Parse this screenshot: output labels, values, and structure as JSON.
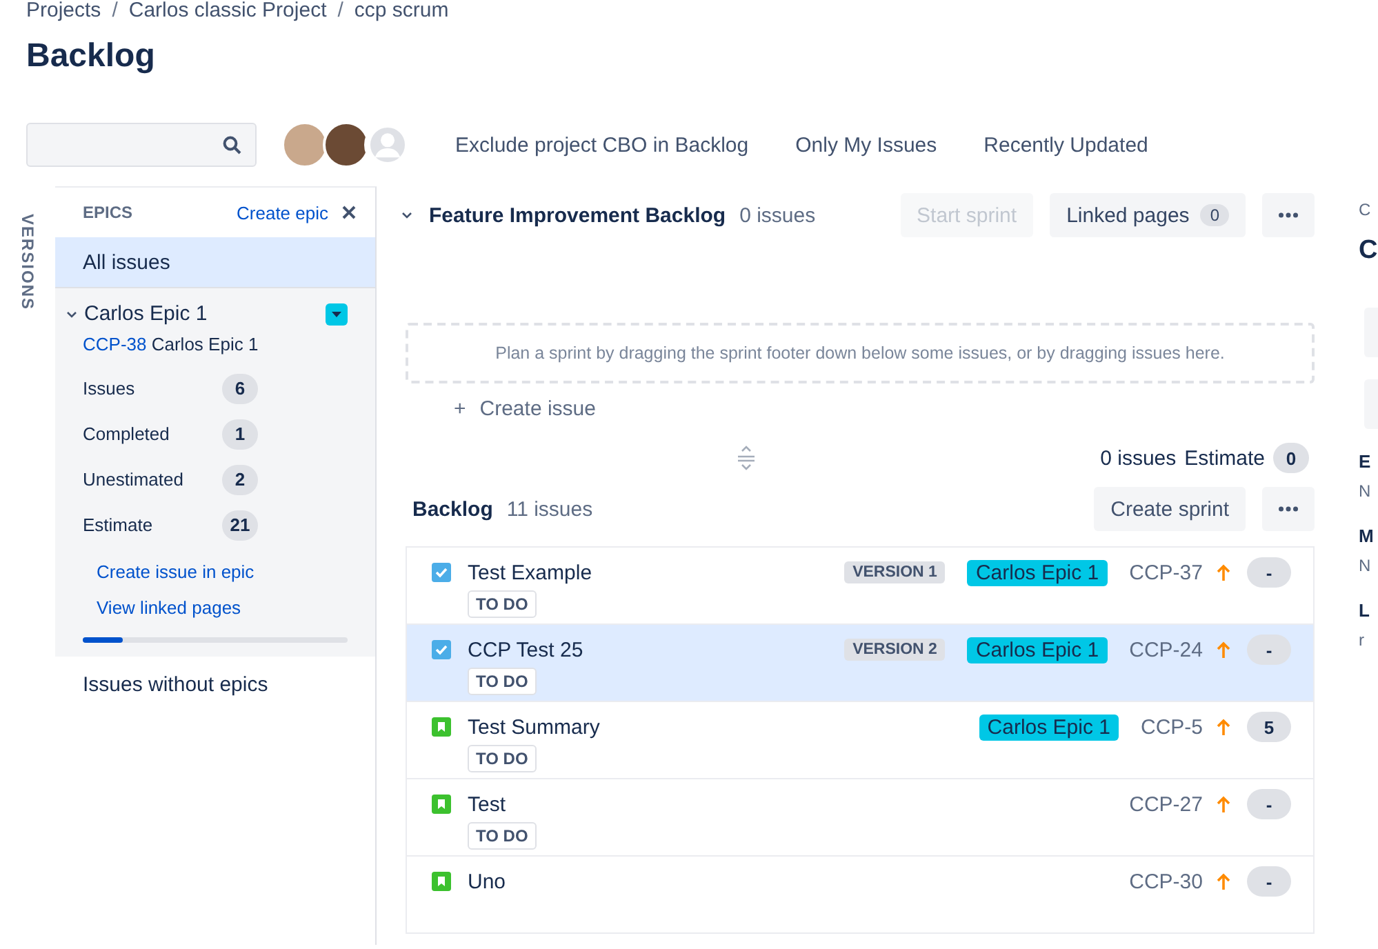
{
  "breadcrumbs": [
    "Projects",
    "Carlos classic Project",
    "ccp scrum"
  ],
  "breadcrumb_separator": "/",
  "title": "Backlog",
  "quick_filters": [
    "Exclude project CBO in Backlog",
    "Only My Issues",
    "Recently Updated"
  ],
  "versions_tab": "VERSIONS",
  "epics_panel": {
    "title": "EPICS",
    "create_link": "Create epic",
    "items": [
      {
        "kind": "all",
        "label": "All issues",
        "selected": true
      },
      {
        "kind": "epic",
        "label": "Carlos Epic 1",
        "selected": false,
        "expanded": true,
        "color": "#00c7e6",
        "key": "CCP-38",
        "summary": "Carlos Epic 1",
        "stats": [
          {
            "label": "Issues",
            "value": "6"
          },
          {
            "label": "Completed",
            "value": "1"
          },
          {
            "label": "Unestimated",
            "value": "2"
          },
          {
            "label": "Estimate",
            "value": "21"
          }
        ],
        "links": [
          "Create issue in epic",
          "View linked pages"
        ],
        "level": 0.15
      },
      {
        "kind": "none",
        "label": "Issues without epics",
        "selected": false
      }
    ]
  },
  "sprint": {
    "title": "Feature Improvement Backlog",
    "count": "0 issues",
    "expanded": true,
    "start_button": {
      "label": "Start sprint",
      "disabled": true
    },
    "linked_pages": {
      "label": "Linked pages",
      "count": "0"
    },
    "placeholder": "Plan a sprint by dragging the sprint footer down below some issues, or by dragging issues here.",
    "create_issue": "Create issue",
    "create_icon": "+",
    "footer_issues": "0 issues",
    "estimate_label": "Estimate",
    "estimate": "0"
  },
  "backlog": {
    "title": "Backlog",
    "count": "11 issues",
    "create_sprint": "Create sprint",
    "issues": [
      {
        "kind": "task",
        "summary": "Test Example",
        "selected": false,
        "version": "VERSION 1",
        "epic": "Carlos Epic 1",
        "color": "#00c7e6",
        "key": "CCP-37",
        "estimate": "-",
        "status": "TO DO"
      },
      {
        "kind": "task",
        "summary": "CCP Test 25",
        "selected": true,
        "version": "VERSION 2",
        "epic": "Carlos Epic 1",
        "color": "#00c7e6",
        "key": "CCP-24",
        "estimate": "-",
        "status": "TO DO"
      },
      {
        "kind": "story",
        "summary": "Test Summary",
        "selected": false,
        "epic": "Carlos Epic 1",
        "color": "#00c7e6",
        "key": "CCP-5",
        "estimate": "5",
        "status": "TO DO"
      },
      {
        "kind": "story",
        "summary": "Test",
        "selected": false,
        "key": "CCP-27",
        "estimate": "-",
        "status": "TO DO"
      },
      {
        "kind": "story",
        "summary": "Uno",
        "selected": false,
        "key": "CCP-30",
        "estimate": "-"
      }
    ]
  },
  "detail_fragments": [
    {
      "kind": "small",
      "text": "C"
    },
    {
      "kind": "big",
      "text": "C"
    },
    {
      "kind": "field"
    },
    {
      "kind": "field"
    },
    {
      "kind": "head",
      "text": "E"
    },
    {
      "kind": "small",
      "text": "N"
    },
    {
      "kind": "head",
      "text": "M"
    },
    {
      "kind": "small",
      "text": "N"
    },
    {
      "kind": "head",
      "text": "L"
    },
    {
      "kind": "small",
      "text": "r"
    }
  ]
}
